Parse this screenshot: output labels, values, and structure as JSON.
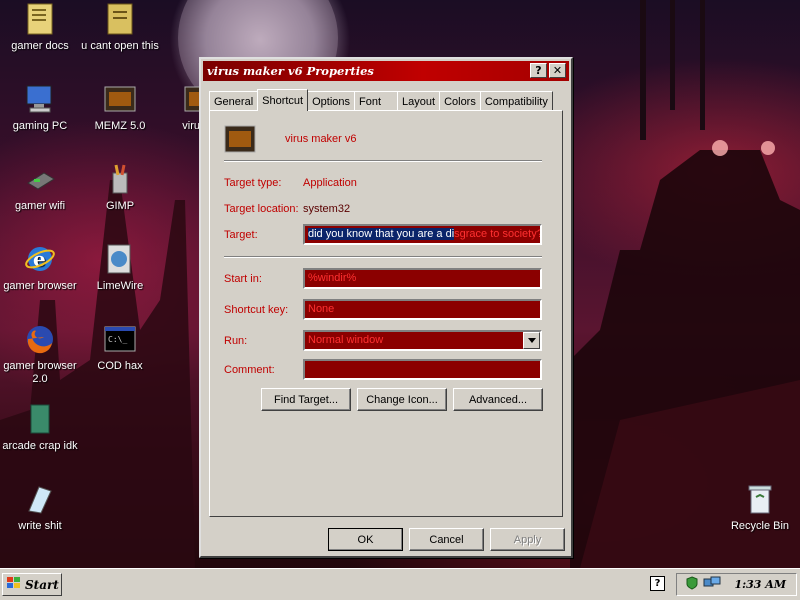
{
  "desktop": {
    "icons": [
      {
        "label": "gamer docs",
        "icon": "folder-docs-icon"
      },
      {
        "label": "u cant open this",
        "icon": "folder-icon"
      },
      {
        "label": "gaming PC",
        "icon": "computer-icon"
      },
      {
        "label": "MEMZ 5.0",
        "icon": "program-icon"
      },
      {
        "label": "virus m",
        "icon": "program-icon"
      },
      {
        "label": "gamer wifi",
        "icon": "network-icon"
      },
      {
        "label": "GIMP",
        "icon": "gimp-icon"
      },
      {
        "label": "gamer browser",
        "icon": "internet-explorer-icon"
      },
      {
        "label": "LimeWire",
        "icon": "limewire-icon"
      },
      {
        "label": "gamer browser 2.0",
        "icon": "firefox-icon"
      },
      {
        "label": "COD hax",
        "icon": "command-prompt-icon"
      },
      {
        "label": "arcade crap idk",
        "icon": "book-icon"
      },
      {
        "label": "write shit",
        "icon": "notepad-icon"
      },
      {
        "label": "Recycle Bin",
        "icon": "recycle-bin-icon"
      }
    ]
  },
  "window": {
    "title": "virus maker v6 Properties",
    "help_btn": "?",
    "close_btn": "✕",
    "tabs": [
      "General",
      "Shortcut",
      "Options",
      "Font",
      "Layout",
      "Colors",
      "Compatibility"
    ],
    "active_tab": "Shortcut",
    "app_name": "virus maker v6",
    "target_type_label": "Target type:",
    "target_type_value": "Application",
    "target_location_label": "Target location:",
    "target_location_value": "system32",
    "target_label": "Target:",
    "target_selected": "did you know that you are a di",
    "target_rest": "sgrace to society?!",
    "start_in_label": "Start in:",
    "start_in_value": "%windir%",
    "shortcut_key_label": "Shortcut key:",
    "shortcut_key_value": "None",
    "run_label": "Run:",
    "run_value": "Normal window",
    "comment_label": "Comment:",
    "comment_value": "",
    "find_target": "Find Target...",
    "change_icon": "Change Icon...",
    "advanced": "Advanced...",
    "ok": "OK",
    "cancel": "Cancel",
    "apply": "Apply"
  },
  "taskbar": {
    "start": "Start",
    "clock": "1:33 AM",
    "help": "?"
  },
  "colors": {
    "accent_red": "#c00000",
    "field_bg": "#8b0000",
    "selection": "#0a246a"
  }
}
